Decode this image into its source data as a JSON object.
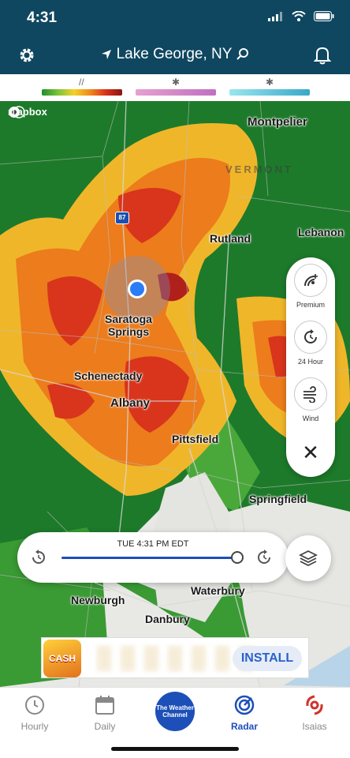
{
  "status": {
    "time": "4:31"
  },
  "header": {
    "location": "Lake George, NY"
  },
  "legend": {
    "rain_symbol": "//",
    "mix_symbol": "✱",
    "snow_symbol": "✱"
  },
  "map": {
    "attribution": "mapbox",
    "cities": {
      "montpelier": "Montpelier",
      "vermont": "VERMONT",
      "lebanon": "Lebanon",
      "rutland": "Rutland",
      "saratoga1": "Saratoga",
      "saratoga2": "Springs",
      "schenectady": "Schenectady",
      "albany": "Albany",
      "pittsfield": "Pittsfield",
      "springfield": "Springfield",
      "newburgh": "Newburgh",
      "waterbury": "Waterbury",
      "danbury": "Danbury",
      "interstate": "87"
    }
  },
  "panel": {
    "premium": "Premium",
    "hour24": "24 Hour",
    "wind": "Wind"
  },
  "timeline": {
    "time": "TUE 4:31 PM EDT",
    "progress": 1.0
  },
  "ad": {
    "logo": "CASH",
    "install": "INSTALL"
  },
  "tabs": {
    "hourly": "Hourly",
    "daily": "Daily",
    "brand": "The Weather Channel",
    "radar": "Radar",
    "isaias": "Isaias"
  },
  "colors": {
    "header": "#0f4760",
    "accent": "#1d4fb8",
    "hurricane": "#d0342c"
  }
}
